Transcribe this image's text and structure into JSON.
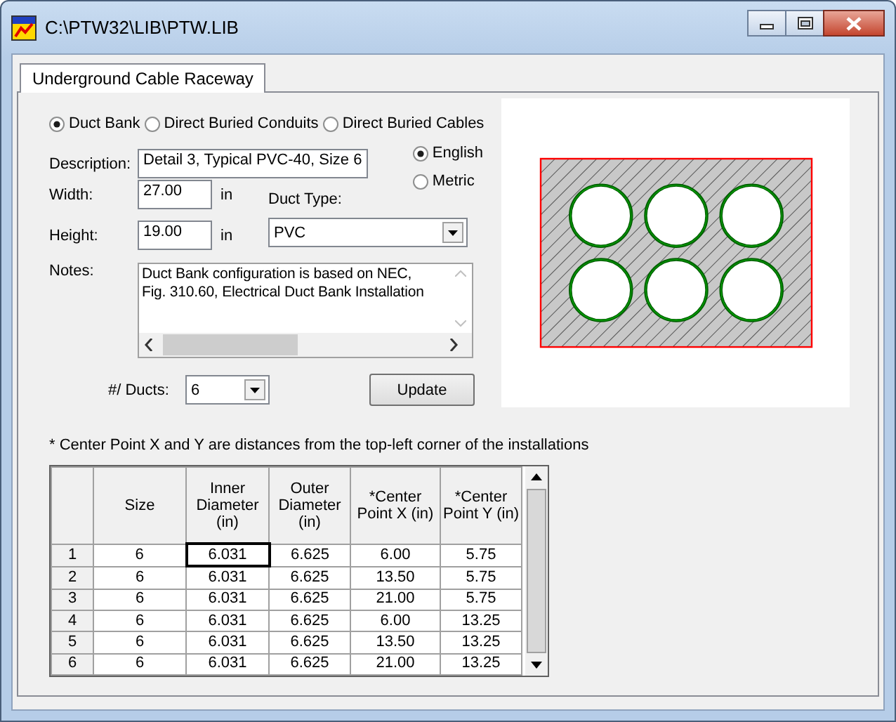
{
  "window": {
    "title": "C:\\PTW32\\LIB\\PTW.LIB"
  },
  "tabs": [
    {
      "label": "Underground Cable Raceway",
      "selected": true
    }
  ],
  "raceway_types": [
    {
      "label": "Duct Bank",
      "selected": true
    },
    {
      "label": "Direct Buried Conduits",
      "selected": false
    },
    {
      "label": "Direct Buried Cables",
      "selected": false
    }
  ],
  "description": {
    "label": "Description:",
    "value": "Detail 3, Typical PVC-40, Size 6"
  },
  "units": [
    {
      "label": "English",
      "selected": true
    },
    {
      "label": "Metric",
      "selected": false
    }
  ],
  "width": {
    "label": "Width:",
    "value": "27.00",
    "unit": "in"
  },
  "height": {
    "label": "Height:",
    "value": "19.00",
    "unit": "in"
  },
  "duct_type": {
    "label": "Duct Type:",
    "value": "PVC"
  },
  "notes": {
    "label": "Notes:",
    "value": "Duct Bank configuration is based on NEC,\nFig. 310.60, Electrical Duct Bank Installation"
  },
  "duct_count": {
    "label": "#/ Ducts:",
    "value": "6"
  },
  "update_button": "Update",
  "footnote": "* Center Point X and Y are distances from the top-left corner of the installations",
  "table": {
    "columns": [
      "Size",
      "Inner Diameter (in)",
      "Outer Diameter (in)",
      "*Center Point X (in)",
      "*Center Point Y (in)"
    ],
    "rows": [
      {
        "number": "1",
        "cells": [
          {
            "text": "6",
            "selected": false
          },
          {
            "text": "6.031",
            "selected": true
          },
          {
            "text": "6.625",
            "selected": false
          },
          {
            "text": "6.00",
            "selected": false
          },
          {
            "text": "5.75",
            "selected": false
          }
        ]
      },
      {
        "number": "2",
        "cells": [
          {
            "text": "6",
            "selected": false
          },
          {
            "text": "6.031",
            "selected": false
          },
          {
            "text": "6.625",
            "selected": false
          },
          {
            "text": "13.50",
            "selected": false
          },
          {
            "text": "5.75",
            "selected": false
          }
        ]
      },
      {
        "number": "3",
        "cells": [
          {
            "text": "6",
            "selected": false
          },
          {
            "text": "6.031",
            "selected": false
          },
          {
            "text": "6.625",
            "selected": false
          },
          {
            "text": "21.00",
            "selected": false
          },
          {
            "text": "5.75",
            "selected": false
          }
        ]
      },
      {
        "number": "4",
        "cells": [
          {
            "text": "6",
            "selected": false
          },
          {
            "text": "6.031",
            "selected": false
          },
          {
            "text": "6.625",
            "selected": false
          },
          {
            "text": "6.00",
            "selected": false
          },
          {
            "text": "13.25",
            "selected": false
          }
        ]
      },
      {
        "number": "5",
        "cells": [
          {
            "text": "6",
            "selected": false
          },
          {
            "text": "6.031",
            "selected": false
          },
          {
            "text": "6.625",
            "selected": false
          },
          {
            "text": "13.50",
            "selected": false
          },
          {
            "text": "13.25",
            "selected": false
          }
        ]
      },
      {
        "number": "6",
        "cells": [
          {
            "text": "6",
            "selected": false
          },
          {
            "text": "6.031",
            "selected": false
          },
          {
            "text": "6.625",
            "selected": false
          },
          {
            "text": "21.00",
            "selected": false
          },
          {
            "text": "13.25",
            "selected": false
          }
        ]
      }
    ]
  }
}
